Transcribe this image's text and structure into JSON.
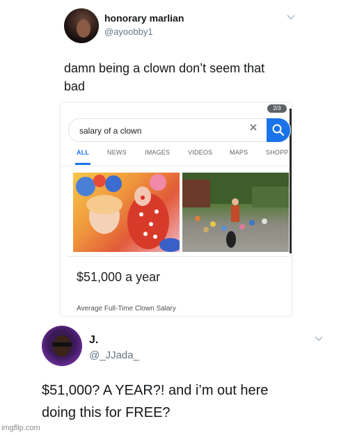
{
  "tweet1": {
    "name": "honorary marlian",
    "handle": "@ayoobby1",
    "text_line1": "damn being a clown don’t seem that",
    "text_line2": "bad"
  },
  "search_card": {
    "pager_badge": "2/3",
    "query": "salary of a clown",
    "tabs": [
      "ALL",
      "NEWS",
      "IMAGES",
      "VIDEOS",
      "MAPS",
      "SHOPP"
    ],
    "active_tab": "ALL",
    "salary_value": "$51,000 a year",
    "salary_caption": "Average Full-Time Clown Salary",
    "accent_color": "#1a73e8"
  },
  "tweet2": {
    "name": "J.",
    "handle": "@_JJada_",
    "text_line1": "$51,000? A YEAR?! and i’m out here",
    "text_line2": "doing this for FREE?"
  },
  "watermark": "imgflip.com",
  "icons": [
    "chevron-down-icon",
    "clear-icon",
    "search-icon"
  ]
}
